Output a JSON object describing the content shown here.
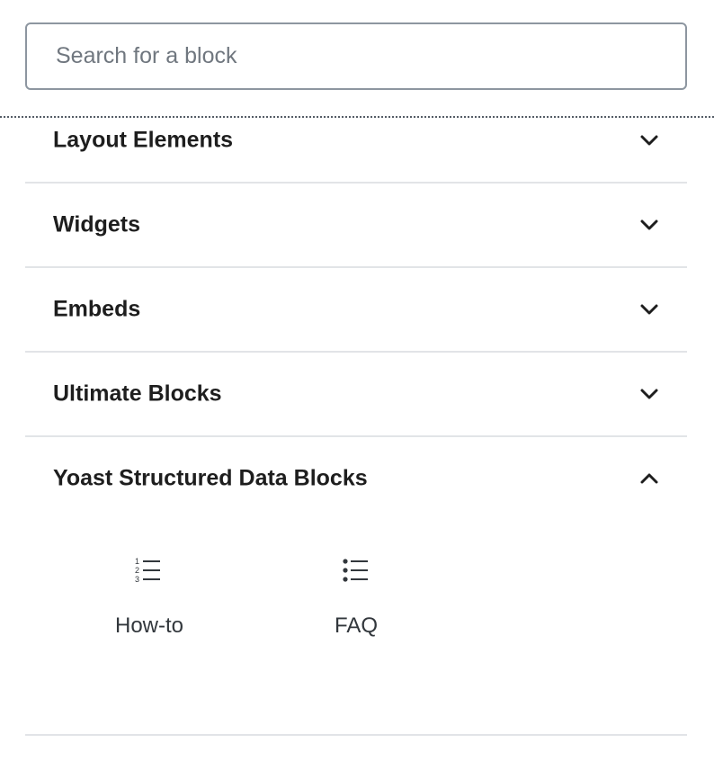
{
  "search": {
    "placeholder": "Search for a block",
    "value": ""
  },
  "panels": [
    {
      "title": "Layout Elements",
      "expanded": false,
      "chevron": "chevron-down-icon"
    },
    {
      "title": "Widgets",
      "expanded": false,
      "chevron": "chevron-down-icon"
    },
    {
      "title": "Embeds",
      "expanded": false,
      "chevron": "chevron-down-icon"
    },
    {
      "title": "Ultimate Blocks",
      "expanded": false,
      "chevron": "chevron-down-icon"
    },
    {
      "title": "Yoast Structured Data Blocks",
      "expanded": true,
      "chevron": "chevron-up-icon",
      "blocks": [
        {
          "label": "How-to",
          "icon": "numbered-list-icon"
        },
        {
          "label": "FAQ",
          "icon": "bulleted-list-icon"
        }
      ]
    }
  ],
  "colors": {
    "text": "#1e1e1e",
    "border": "#e2e4e7",
    "input_border": "#8d96a0",
    "placeholder": "#70777f"
  }
}
